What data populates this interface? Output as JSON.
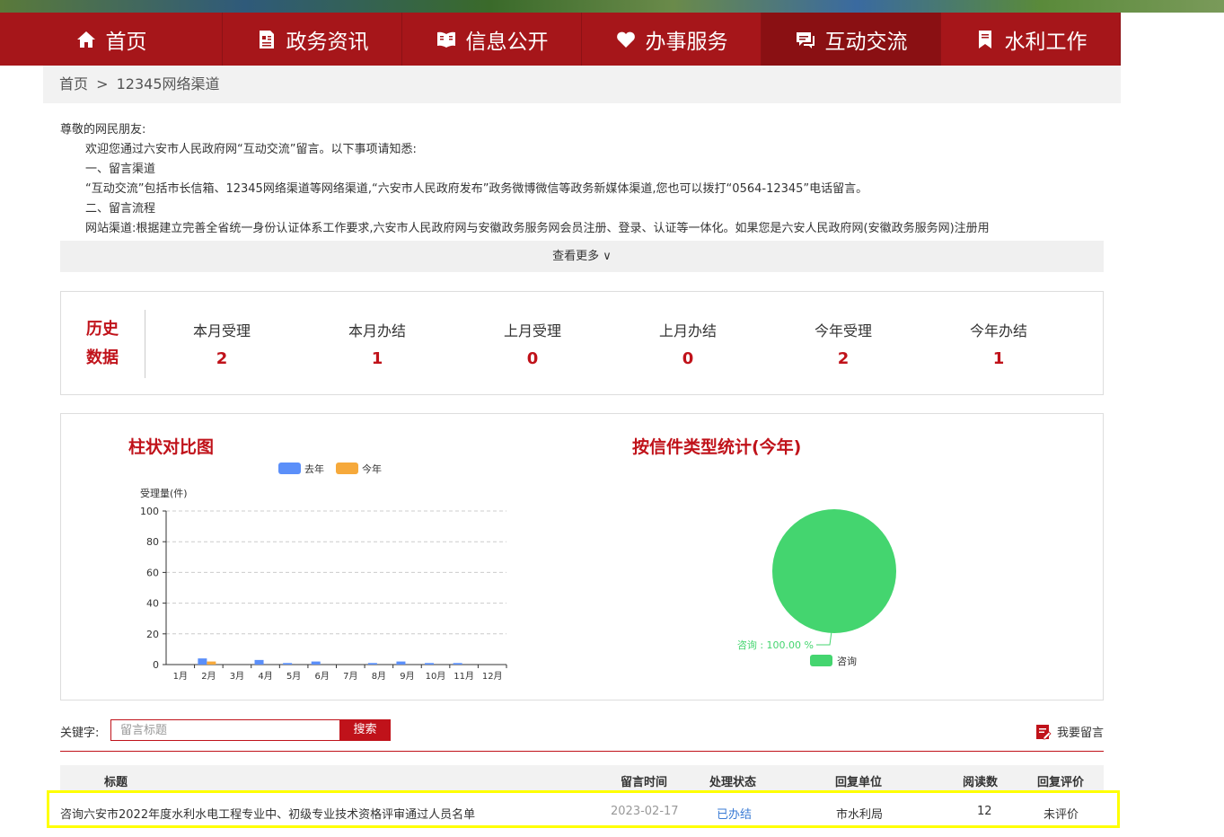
{
  "nav": {
    "items": [
      {
        "label": "首页",
        "icon": "home-icon"
      },
      {
        "label": "政务资讯",
        "icon": "document-icon"
      },
      {
        "label": "信息公开",
        "icon": "open-book-icon"
      },
      {
        "label": "办事服务",
        "icon": "heart-icon"
      },
      {
        "label": "互动交流",
        "icon": "chat-icon"
      },
      {
        "label": "水利工作",
        "icon": "bookmark-icon"
      }
    ],
    "active_index": 4
  },
  "breadcrumb": {
    "home": "首页",
    "sep": ">",
    "current": "12345网络渠道"
  },
  "notice": {
    "greeting": "尊敬的网民朋友:",
    "intro": "欢迎您通过六安市人民政府网“互动交流”留言。以下事项请知悉:",
    "h1": "一、留言渠道",
    "p1": "“互动交流”包括市长信箱、12345网络渠道等网络渠道,“六安市人民政府发布”政务微博微信等政务新媒体渠道,您也可以拨打“0564-12345”电话留言。",
    "h2": "二、留言流程",
    "p2": "网站渠道:根据建立完善全省统一身份认证体系工作要求,六安市人民政府网与安徽政务服务网会员注册、登录、认证等一体化。如果您是六安人民政府网(安徽政务服务网)注册用"
  },
  "more_label": "查看更多 ∨",
  "stats": {
    "title_line1": "历史",
    "title_line2": "数据",
    "items": [
      {
        "label": "本月受理",
        "value": "2"
      },
      {
        "label": "本月办结",
        "value": "1"
      },
      {
        "label": "上月受理",
        "value": "0"
      },
      {
        "label": "上月办结",
        "value": "0"
      },
      {
        "label": "今年受理",
        "value": "2"
      },
      {
        "label": "今年办结",
        "value": "1"
      }
    ]
  },
  "chart_data": [
    {
      "type": "bar",
      "title": "柱状对比图",
      "ylabel": "受理量(件)",
      "xlabel": "",
      "ylim": [
        0,
        100
      ],
      "yticks": [
        0,
        20,
        40,
        60,
        80,
        100
      ],
      "grid": true,
      "legend": "top",
      "categories": [
        "1月",
        "2月",
        "3月",
        "4月",
        "5月",
        "6月",
        "7月",
        "8月",
        "9月",
        "10月",
        "11月",
        "12月"
      ],
      "series": [
        {
          "name": "去年",
          "color": "#5b8ff9",
          "values": [
            0,
            4,
            0,
            3,
            1,
            2,
            0,
            1,
            2,
            1,
            1,
            0
          ]
        },
        {
          "name": "今年",
          "color": "#f6a93b",
          "values": [
            0,
            2,
            0,
            0,
            0,
            0,
            0,
            0,
            0,
            0,
            0,
            0
          ]
        }
      ]
    },
    {
      "type": "pie",
      "title": "按信件类型统计(今年)",
      "legend": "bottom",
      "slices": [
        {
          "name": "咨询",
          "value": 100.0,
          "label": "咨询 : 100.00 %",
          "color": "#44d56f"
        }
      ]
    }
  ],
  "search": {
    "label": "关键字:",
    "placeholder": "留言标题",
    "button": "搜索",
    "leave_message": "我要留言"
  },
  "table": {
    "headers": [
      "标题",
      "留言时间",
      "处理状态",
      "回复单位",
      "阅读数",
      "回复评价"
    ],
    "rows": [
      {
        "title": "咨询六安市2022年度水利水电工程专业中、初级专业技术资格评审通过人员名单",
        "date": "2023-02-17",
        "status": "已办结",
        "unit": "市水利局",
        "reads": "12",
        "rating": "未评价"
      }
    ]
  },
  "colors": {
    "brand": "#a6161a",
    "accent": "#c0121a",
    "link": "#3a7bd5",
    "highlight": "#ffff00"
  }
}
